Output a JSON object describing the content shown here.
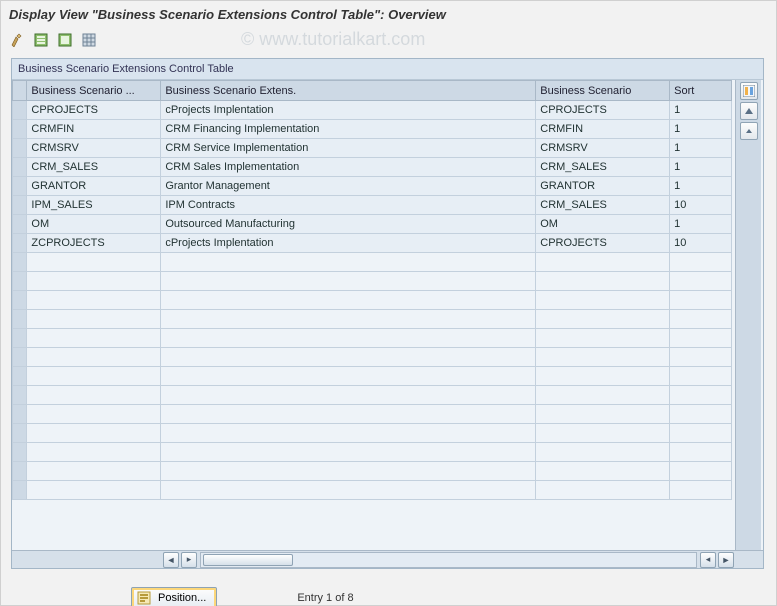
{
  "window": {
    "title": "Display View \"Business Scenario Extensions Control Table\": Overview"
  },
  "watermark": "© www.tutorialkart.com",
  "panel": {
    "title": "Business Scenario Extensions Control Table"
  },
  "table": {
    "columns": {
      "col_a": "Business Scenario ...",
      "col_b": "Business Scenario Extens.",
      "col_c": "Business Scenario",
      "col_d": "Sort"
    },
    "rows": [
      {
        "a": "CPROJECTS",
        "b": "cProjects Implentation",
        "c": "CPROJECTS",
        "d": "1"
      },
      {
        "a": "CRMFIN",
        "b": "CRM Financing Implementation",
        "c": "CRMFIN",
        "d": "1"
      },
      {
        "a": "CRMSRV",
        "b": "CRM Service Implementation",
        "c": "CRMSRV",
        "d": "1"
      },
      {
        "a": "CRM_SALES",
        "b": "CRM Sales Implementation",
        "c": "CRM_SALES",
        "d": "1"
      },
      {
        "a": "GRANTOR",
        "b": "Grantor Management",
        "c": "GRANTOR",
        "d": "1"
      },
      {
        "a": "IPM_SALES",
        "b": "IPM Contracts",
        "c": "CRM_SALES",
        "d": "10"
      },
      {
        "a": "OM",
        "b": "Outsourced Manufacturing",
        "c": "OM",
        "d": "1"
      },
      {
        "a": "ZCPROJECTS",
        "b": "cProjects Implentation",
        "c": "CPROJECTS",
        "d": "10"
      }
    ],
    "empty_rows": 13
  },
  "footer": {
    "position_label": "Position...",
    "entry_text": "Entry 1 of 8"
  },
  "toolbar": {
    "icons": [
      "tool-icon-1",
      "select-all-icon",
      "deselect-all-icon",
      "table-settings-icon"
    ]
  },
  "colors": {
    "panel_header": "#d9e4ef",
    "grid_header": "#cdd9e5",
    "grid_cell": "#e7eef5"
  }
}
